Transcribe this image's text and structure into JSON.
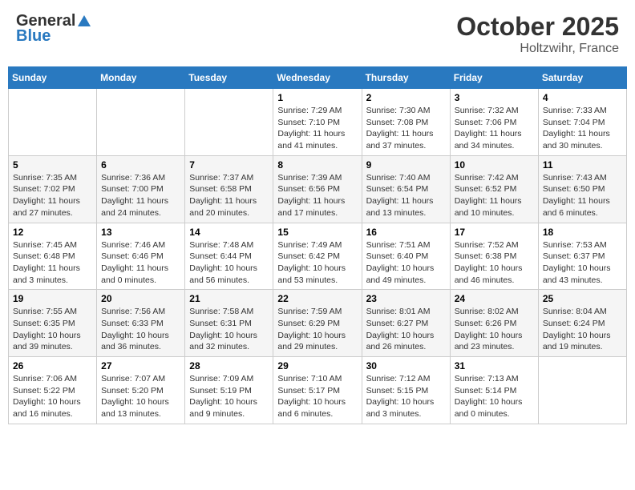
{
  "header": {
    "logo_general": "General",
    "logo_blue": "Blue",
    "month": "October 2025",
    "location": "Holtzwihr, France"
  },
  "weekdays": [
    "Sunday",
    "Monday",
    "Tuesday",
    "Wednesday",
    "Thursday",
    "Friday",
    "Saturday"
  ],
  "weeks": [
    [
      {
        "day": "",
        "sunrise": "",
        "sunset": "",
        "daylight": ""
      },
      {
        "day": "",
        "sunrise": "",
        "sunset": "",
        "daylight": ""
      },
      {
        "day": "",
        "sunrise": "",
        "sunset": "",
        "daylight": ""
      },
      {
        "day": "1",
        "sunrise": "Sunrise: 7:29 AM",
        "sunset": "Sunset: 7:10 PM",
        "daylight": "Daylight: 11 hours and 41 minutes."
      },
      {
        "day": "2",
        "sunrise": "Sunrise: 7:30 AM",
        "sunset": "Sunset: 7:08 PM",
        "daylight": "Daylight: 11 hours and 37 minutes."
      },
      {
        "day": "3",
        "sunrise": "Sunrise: 7:32 AM",
        "sunset": "Sunset: 7:06 PM",
        "daylight": "Daylight: 11 hours and 34 minutes."
      },
      {
        "day": "4",
        "sunrise": "Sunrise: 7:33 AM",
        "sunset": "Sunset: 7:04 PM",
        "daylight": "Daylight: 11 hours and 30 minutes."
      }
    ],
    [
      {
        "day": "5",
        "sunrise": "Sunrise: 7:35 AM",
        "sunset": "Sunset: 7:02 PM",
        "daylight": "Daylight: 11 hours and 27 minutes."
      },
      {
        "day": "6",
        "sunrise": "Sunrise: 7:36 AM",
        "sunset": "Sunset: 7:00 PM",
        "daylight": "Daylight: 11 hours and 24 minutes."
      },
      {
        "day": "7",
        "sunrise": "Sunrise: 7:37 AM",
        "sunset": "Sunset: 6:58 PM",
        "daylight": "Daylight: 11 hours and 20 minutes."
      },
      {
        "day": "8",
        "sunrise": "Sunrise: 7:39 AM",
        "sunset": "Sunset: 6:56 PM",
        "daylight": "Daylight: 11 hours and 17 minutes."
      },
      {
        "day": "9",
        "sunrise": "Sunrise: 7:40 AM",
        "sunset": "Sunset: 6:54 PM",
        "daylight": "Daylight: 11 hours and 13 minutes."
      },
      {
        "day": "10",
        "sunrise": "Sunrise: 7:42 AM",
        "sunset": "Sunset: 6:52 PM",
        "daylight": "Daylight: 11 hours and 10 minutes."
      },
      {
        "day": "11",
        "sunrise": "Sunrise: 7:43 AM",
        "sunset": "Sunset: 6:50 PM",
        "daylight": "Daylight: 11 hours and 6 minutes."
      }
    ],
    [
      {
        "day": "12",
        "sunrise": "Sunrise: 7:45 AM",
        "sunset": "Sunset: 6:48 PM",
        "daylight": "Daylight: 11 hours and 3 minutes."
      },
      {
        "day": "13",
        "sunrise": "Sunrise: 7:46 AM",
        "sunset": "Sunset: 6:46 PM",
        "daylight": "Daylight: 11 hours and 0 minutes."
      },
      {
        "day": "14",
        "sunrise": "Sunrise: 7:48 AM",
        "sunset": "Sunset: 6:44 PM",
        "daylight": "Daylight: 10 hours and 56 minutes."
      },
      {
        "day": "15",
        "sunrise": "Sunrise: 7:49 AM",
        "sunset": "Sunset: 6:42 PM",
        "daylight": "Daylight: 10 hours and 53 minutes."
      },
      {
        "day": "16",
        "sunrise": "Sunrise: 7:51 AM",
        "sunset": "Sunset: 6:40 PM",
        "daylight": "Daylight: 10 hours and 49 minutes."
      },
      {
        "day": "17",
        "sunrise": "Sunrise: 7:52 AM",
        "sunset": "Sunset: 6:38 PM",
        "daylight": "Daylight: 10 hours and 46 minutes."
      },
      {
        "day": "18",
        "sunrise": "Sunrise: 7:53 AM",
        "sunset": "Sunset: 6:37 PM",
        "daylight": "Daylight: 10 hours and 43 minutes."
      }
    ],
    [
      {
        "day": "19",
        "sunrise": "Sunrise: 7:55 AM",
        "sunset": "Sunset: 6:35 PM",
        "daylight": "Daylight: 10 hours and 39 minutes."
      },
      {
        "day": "20",
        "sunrise": "Sunrise: 7:56 AM",
        "sunset": "Sunset: 6:33 PM",
        "daylight": "Daylight: 10 hours and 36 minutes."
      },
      {
        "day": "21",
        "sunrise": "Sunrise: 7:58 AM",
        "sunset": "Sunset: 6:31 PM",
        "daylight": "Daylight: 10 hours and 32 minutes."
      },
      {
        "day": "22",
        "sunrise": "Sunrise: 7:59 AM",
        "sunset": "Sunset: 6:29 PM",
        "daylight": "Daylight: 10 hours and 29 minutes."
      },
      {
        "day": "23",
        "sunrise": "Sunrise: 8:01 AM",
        "sunset": "Sunset: 6:27 PM",
        "daylight": "Daylight: 10 hours and 26 minutes."
      },
      {
        "day": "24",
        "sunrise": "Sunrise: 8:02 AM",
        "sunset": "Sunset: 6:26 PM",
        "daylight": "Daylight: 10 hours and 23 minutes."
      },
      {
        "day": "25",
        "sunrise": "Sunrise: 8:04 AM",
        "sunset": "Sunset: 6:24 PM",
        "daylight": "Daylight: 10 hours and 19 minutes."
      }
    ],
    [
      {
        "day": "26",
        "sunrise": "Sunrise: 7:06 AM",
        "sunset": "Sunset: 5:22 PM",
        "daylight": "Daylight: 10 hours and 16 minutes."
      },
      {
        "day": "27",
        "sunrise": "Sunrise: 7:07 AM",
        "sunset": "Sunset: 5:20 PM",
        "daylight": "Daylight: 10 hours and 13 minutes."
      },
      {
        "day": "28",
        "sunrise": "Sunrise: 7:09 AM",
        "sunset": "Sunset: 5:19 PM",
        "daylight": "Daylight: 10 hours and 9 minutes."
      },
      {
        "day": "29",
        "sunrise": "Sunrise: 7:10 AM",
        "sunset": "Sunset: 5:17 PM",
        "daylight": "Daylight: 10 hours and 6 minutes."
      },
      {
        "day": "30",
        "sunrise": "Sunrise: 7:12 AM",
        "sunset": "Sunset: 5:15 PM",
        "daylight": "Daylight: 10 hours and 3 minutes."
      },
      {
        "day": "31",
        "sunrise": "Sunrise: 7:13 AM",
        "sunset": "Sunset: 5:14 PM",
        "daylight": "Daylight: 10 hours and 0 minutes."
      },
      {
        "day": "",
        "sunrise": "",
        "sunset": "",
        "daylight": ""
      }
    ]
  ]
}
